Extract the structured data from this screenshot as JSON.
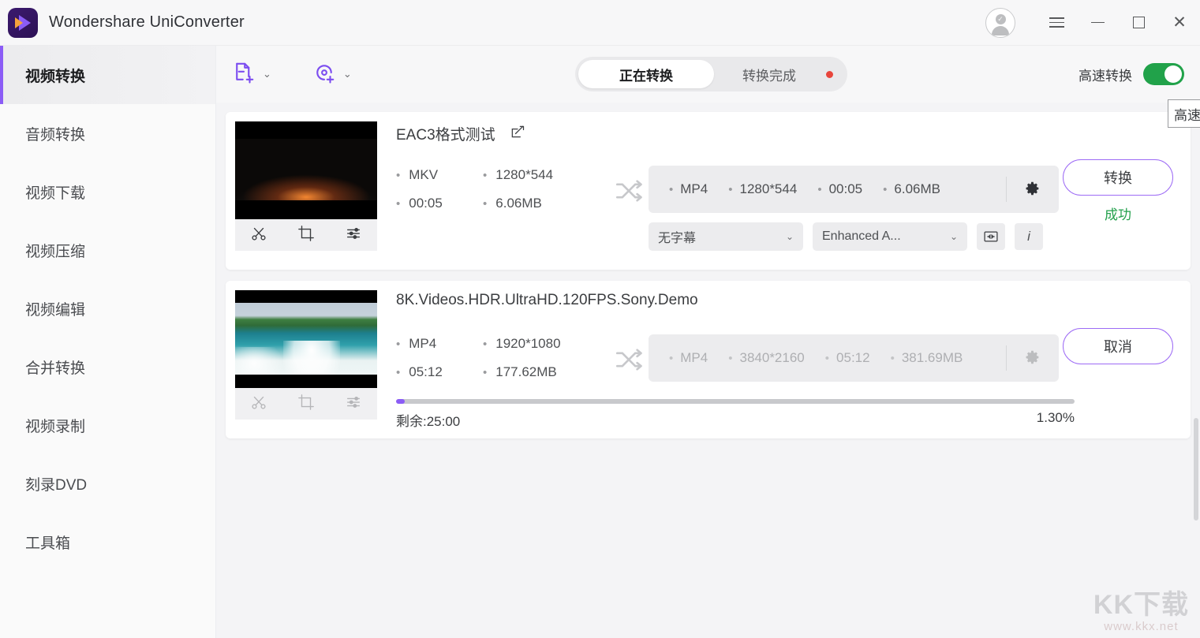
{
  "window": {
    "app_title": "Wondershare UniConverter",
    "controls": {
      "account_icon": "avatar-check-icon",
      "menu_icon": "hamburger-menu-icon",
      "minimize_icon": "minimize-icon",
      "maximize_icon": "maximize-icon",
      "close_icon": "close-icon"
    }
  },
  "sidebar": {
    "items": [
      {
        "label": "视频转换",
        "active": true
      },
      {
        "label": "音频转换",
        "active": false
      },
      {
        "label": "视频下载",
        "active": false
      },
      {
        "label": "视频压缩",
        "active": false
      },
      {
        "label": "视频编辑",
        "active": false
      },
      {
        "label": "合并转换",
        "active": false
      },
      {
        "label": "视频录制",
        "active": false
      },
      {
        "label": "刻录DVD",
        "active": false
      },
      {
        "label": "工具箱",
        "active": false
      }
    ]
  },
  "toolbar": {
    "add_file_icon": "add-file-icon",
    "add_disc_icon": "add-disc-icon",
    "tabs": [
      {
        "label": "正在转换",
        "active": true
      },
      {
        "label": "转换完成",
        "active": false,
        "badge": true
      }
    ],
    "speed_label": "高速转换",
    "speed_enabled": true,
    "tooltip_text": "高速转换已开启"
  },
  "files": [
    {
      "name": "EAC3格式测试",
      "edit_icon": "edit-pencil-icon",
      "thumb_tools": [
        "trim-icon",
        "crop-icon",
        "effects-icon"
      ],
      "thumb_tools_enabled": true,
      "source": {
        "format": "MKV",
        "resolution": "1280*544",
        "duration": "00:05",
        "size": "6.06MB"
      },
      "output": {
        "format": "MP4",
        "resolution": "1280*544",
        "duration": "00:05",
        "size": "6.06MB",
        "dimmed": false
      },
      "subtitle_select": "无字幕",
      "audio_select": "Enhanced A...",
      "compress_icon": "compress-icon",
      "info_icon": "info-icon",
      "action_label": "转换",
      "status_label": "成功",
      "status_color": "#23a04c",
      "progress": null
    },
    {
      "name": "8K.Videos.HDR.UltraHD.120FPS.Sony.Demo",
      "edit_icon": null,
      "thumb_tools": [
        "trim-icon",
        "crop-icon",
        "effects-icon"
      ],
      "thumb_tools_enabled": false,
      "source": {
        "format": "MP4",
        "resolution": "1920*1080",
        "duration": "05:12",
        "size": "177.62MB"
      },
      "output": {
        "format": "MP4",
        "resolution": "3840*2160",
        "duration": "05:12",
        "size": "381.69MB",
        "dimmed": true
      },
      "subtitle_select": null,
      "audio_select": null,
      "action_label": "取消",
      "status_label": null,
      "progress": {
        "remaining_label": "剩余:25:00",
        "percent_label": "1.30%",
        "percent_value": 1.3
      }
    }
  ],
  "watermark": {
    "main": "KK下载",
    "sub": "www.kkx.net"
  },
  "colors": {
    "accent_purple": "#8b5cf6",
    "success_green": "#23a04c",
    "toggle_green": "#21a24a",
    "badge_red": "#e8453c"
  }
}
